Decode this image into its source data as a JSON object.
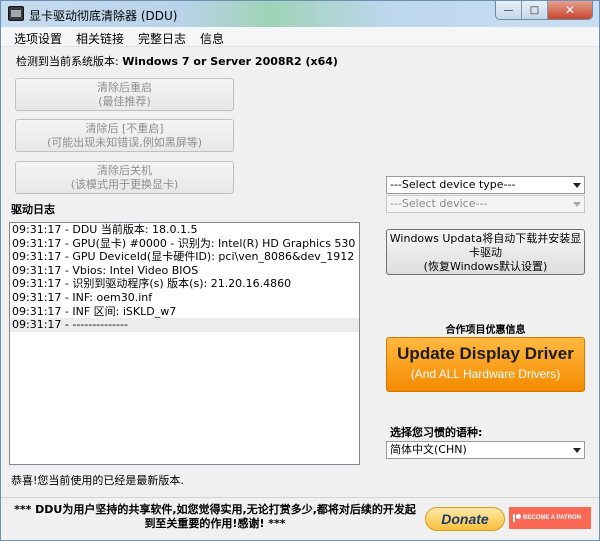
{
  "window": {
    "title": "显卡驱动彻底清除器 (DDU)"
  },
  "title_buttons": {
    "minimize": "—",
    "maximize": "□",
    "close": "✕"
  },
  "menu": {
    "items": [
      "选项设置",
      "相关链接",
      "完整日志",
      "信息"
    ]
  },
  "detected": {
    "label": "检测到当前系统版本:",
    "value": "Windows 7 or Server 2008R2 (x64)"
  },
  "actions": [
    {
      "line1": "清除后重启",
      "line2": "(最佳推荐)"
    },
    {
      "line1": "清除后 [不重启]",
      "line2": "(可能出现未知错误,例如黑屏等)"
    },
    {
      "line1": "清除后关机",
      "line2": "(该模式用于更换显卡)"
    }
  ],
  "log": {
    "title": "驱动日志",
    "lines": [
      "09:31:17 - DDU 当前版本: 18.0.1.5",
      "09:31:17 - GPU(显卡) #0000 - 识别为: Intel(R) HD Graphics 530",
      "09:31:17 - GPU DeviceId(显卡硬件ID): pci\\ven_8086&dev_1912",
      "09:31:17 - Vbios: Intel Video BIOS",
      "09:31:17 - 识别到驱动程序(s) 版本(s): 21.20.16.4860",
      "09:31:17 - INF: oem30.inf",
      "09:31:17 - INF 区间: iSKLD_w7",
      "09:31:17 - --------------"
    ]
  },
  "status": "恭喜!您当前使用的已经是最新版本.",
  "device_type_select": {
    "value": "---Select device type---"
  },
  "device_select": {
    "value": "---Select device---"
  },
  "windows_update_button": {
    "line1": "Windows Updata将自动下载并安装显",
    "line2": "卡驱动",
    "line3": "(恢复Windows默认设置)"
  },
  "partner": {
    "label": "合作项目优惠信息",
    "title": "Update Display Driver",
    "subtitle": "(And ALL Hardware Drivers)"
  },
  "language": {
    "label": "选择您习惯的语种:",
    "value": "简体中文(CHN)"
  },
  "footer": {
    "message": "*** DDU为用户坚持的共享软件,如您觉得实用,无论打赏多少,都将对后续的开发起到至关重要的作用!感谢! ***",
    "donate_label": "Donate",
    "patron_label": "BECOME A PATRON"
  }
}
